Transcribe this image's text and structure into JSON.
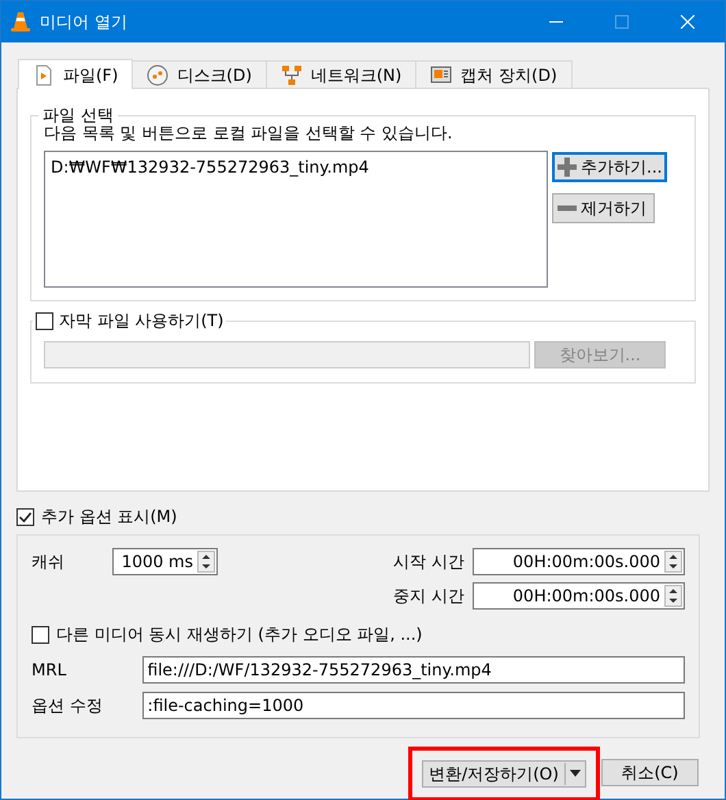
{
  "window": {
    "title": "미디어 열기"
  },
  "tabs": [
    {
      "label": "파일(F)",
      "selected": true
    },
    {
      "label": "디스크(D)",
      "selected": false
    },
    {
      "label": "네트워크(N)",
      "selected": false
    },
    {
      "label": "캡처 장치(D)",
      "selected": false
    }
  ],
  "file_selection": {
    "title": "파일 선택",
    "description": "다음 목록 및 버튼으로 로컬 파일을 선택할 수 있습니다.",
    "files": [
      "D:₩WF₩132932-755272963_tiny.mp4"
    ],
    "add_button": "추가하기...",
    "remove_button": "제거하기"
  },
  "subtitle": {
    "label": "자막 파일 사용하기(T)",
    "checked": false,
    "browse_button": "찾아보기..."
  },
  "show_more_options": {
    "label": "추가 옵션 표시(M)",
    "checked": true
  },
  "options": {
    "cache_label": "캐쉬",
    "cache_value": "1000 ms",
    "start_label": "시작 시간",
    "start_value": "00H:00m:00s.000",
    "stop_label": "중지 시간",
    "stop_value": "00H:00m:00s.000",
    "sync_play": {
      "label": "다른 미디어 동시 재생하기 (추가 오디오 파일, ...)",
      "checked": false
    },
    "mrl_label": "MRL",
    "mrl_value": "file:///D:/WF/132932-755272963_tiny.mp4",
    "edit_options_label": "옵션 수정",
    "edit_options_value": ":file-caching=1000"
  },
  "buttons": {
    "convert": {
      "label": "변환/저장하기(O)",
      "highlighted": true
    },
    "cancel": "취소(C)"
  }
}
